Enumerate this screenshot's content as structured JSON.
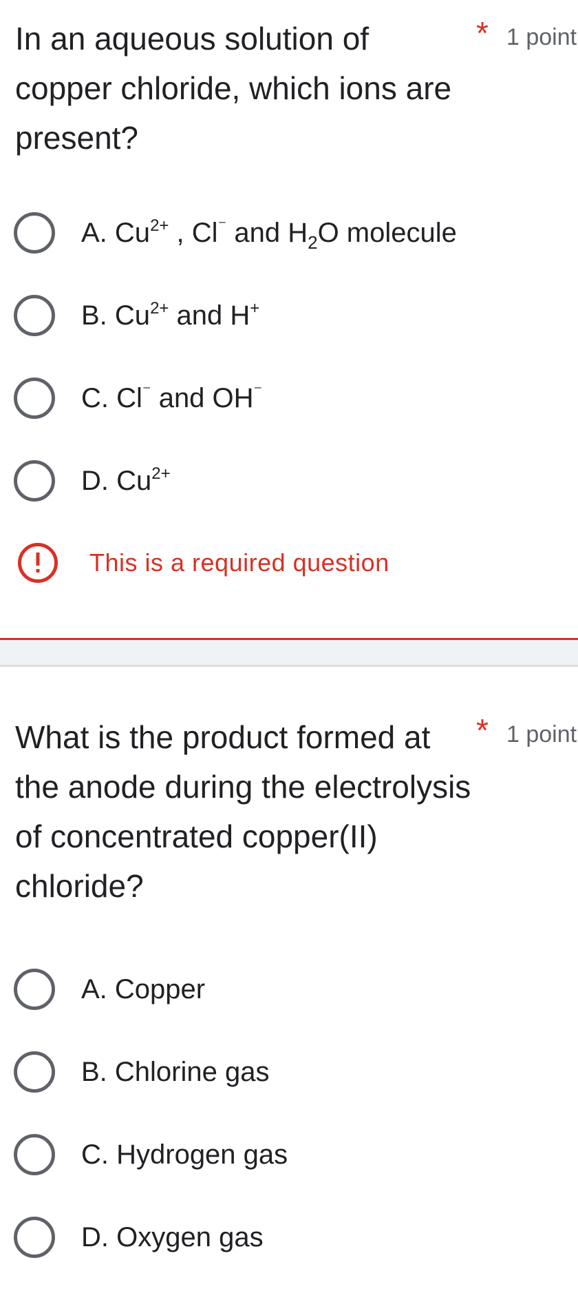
{
  "questions": [
    {
      "title": "In an aqueous solution of copper chloride, which ions are present?",
      "required_marker": "*",
      "points": "1 point",
      "options": [
        {
          "letter": "A.",
          "parts": [
            "Cu",
            "2+",
            " , Cl",
            "⁻",
            " and H",
            "2",
            "O molecule"
          ]
        },
        {
          "letter": "B.",
          "parts": [
            "Cu",
            "2+",
            " and H",
            "+"
          ]
        },
        {
          "letter": "C.",
          "parts": [
            "Cl",
            "⁻",
            " and OH",
            "⁻"
          ]
        },
        {
          "letter": "D.",
          "parts": [
            "Cu",
            "2+"
          ]
        }
      ],
      "error_message": "This is a required question"
    },
    {
      "title": "What is the product formed at the anode during the electrolysis of concentrated copper(II) chloride?",
      "required_marker": "*",
      "points": "1 point",
      "options": [
        {
          "label": "A. Copper"
        },
        {
          "label": "B. Chlorine gas"
        },
        {
          "label": "C. Hydrogen gas"
        },
        {
          "label": "D. Oxygen gas"
        }
      ]
    }
  ],
  "icons": {
    "radio": "radio-unchecked-icon",
    "error": "exclamation-circle-icon"
  },
  "colors": {
    "text": "#202124",
    "required": "#d93025",
    "error": "#d93025",
    "secondary": "#5f6368",
    "radio_border": "#5f6368",
    "section_gap": "#f0f3f5"
  }
}
